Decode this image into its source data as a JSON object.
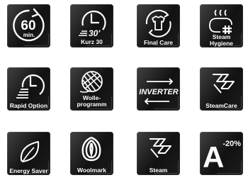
{
  "icons": [
    {
      "name": "timer-60-icon",
      "big": "60",
      "small": "min."
    },
    {
      "name": "kurz-30-icon",
      "big": "30'",
      "label": "Kurz 30"
    },
    {
      "name": "final-care-icon",
      "label": "Final Care"
    },
    {
      "name": "steam-hygiene-icon",
      "label_line1": "Steam",
      "label_line2": "Hygiene"
    },
    {
      "name": "rapid-option-icon",
      "label": "Rapid Option"
    },
    {
      "name": "wolle-programm-icon",
      "label_line1": "Wolle-",
      "label_line2": "programm"
    },
    {
      "name": "inverter-icon",
      "big": "INVERTER"
    },
    {
      "name": "steamcare-icon",
      "label": "SteamCare"
    },
    {
      "name": "energy-saver-icon",
      "label": "Energy Saver"
    },
    {
      "name": "woolmark-icon",
      "label": "Woolmark"
    },
    {
      "name": "steam-icon",
      "label": "Steam"
    },
    {
      "name": "minus-20-percent-icon",
      "big": "A",
      "small": "-20%"
    }
  ]
}
